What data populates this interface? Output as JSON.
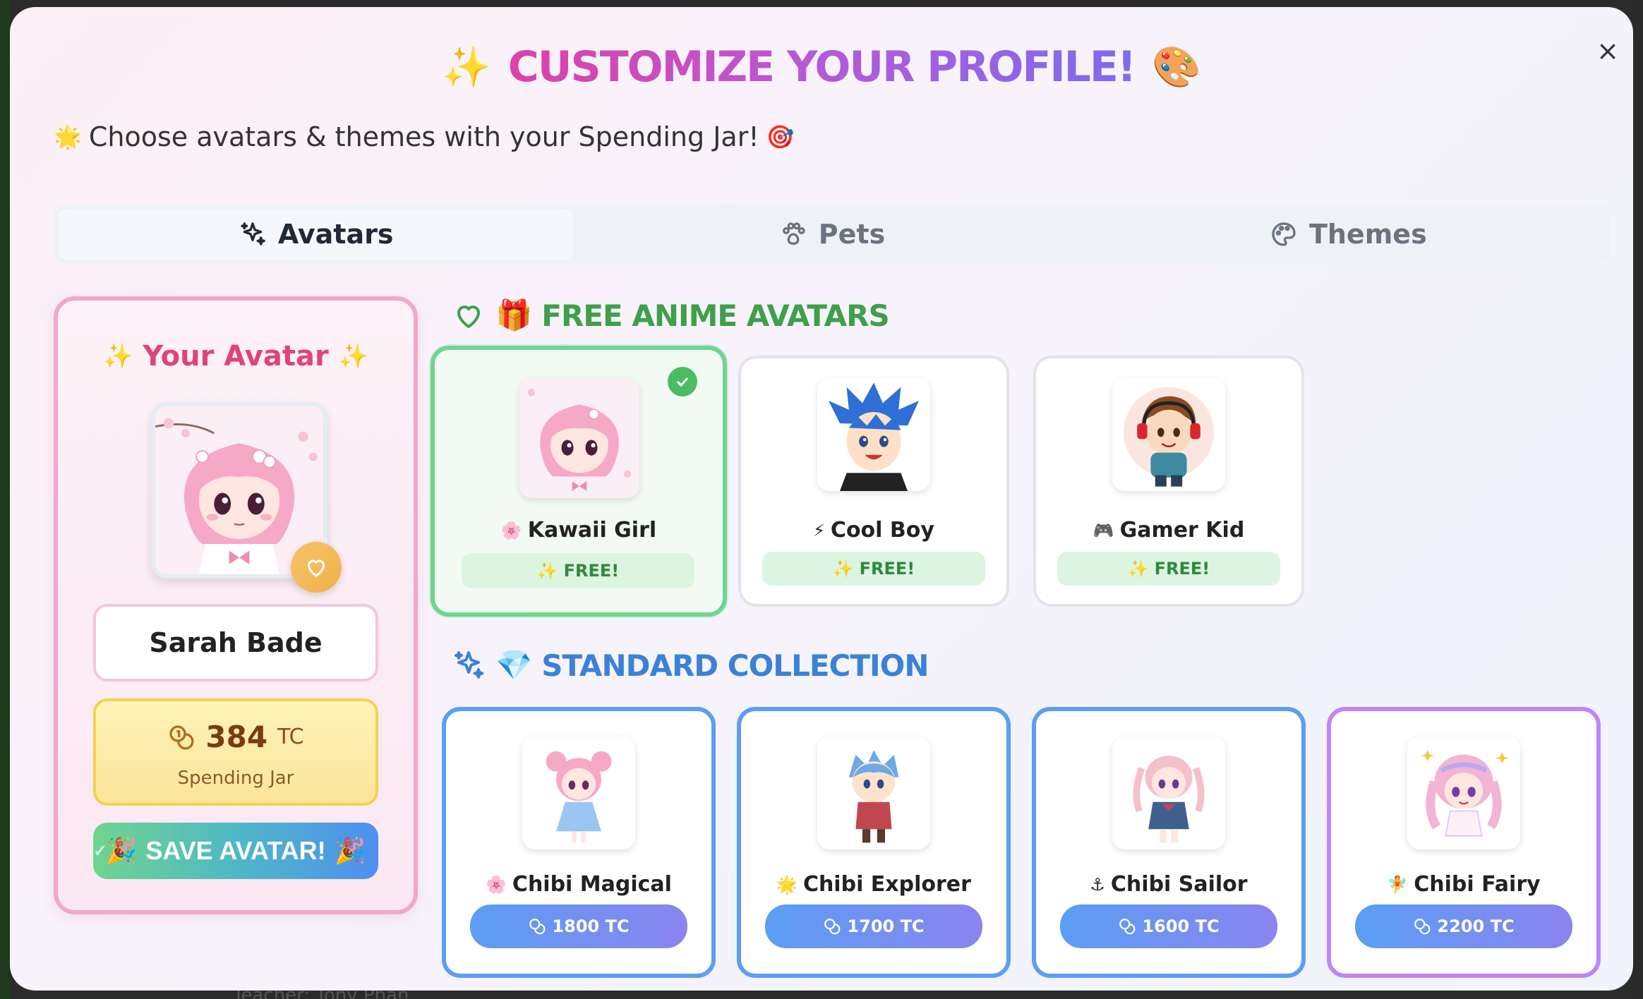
{
  "background": {
    "bottom_text": "Teacher: Tony Phan"
  },
  "modal": {
    "title": "CUSTOMIZE YOUR PROFILE!",
    "title_left_emoji": "✨",
    "title_right_emoji": "🎨",
    "subtitle_emoji": "🌟",
    "subtitle": "Choose avatars & themes with your Spending Jar!",
    "subtitle_end_emoji": "🎯",
    "close_label": "×"
  },
  "tabs": [
    {
      "label": "Avatars",
      "icon": "sparkles-icon",
      "active": true
    },
    {
      "label": "Pets",
      "icon": "paw-icon",
      "active": false
    },
    {
      "label": "Themes",
      "icon": "palette-icon",
      "active": false
    }
  ],
  "profile": {
    "heading": "Your Avatar",
    "heading_emoji": "✨",
    "name": "Sarah Bade",
    "balance": "384",
    "balance_unit": "TC",
    "balance_label": "Spending Jar",
    "save_label": "SAVE AVATAR!",
    "save_emoji": "🎉"
  },
  "sections": {
    "free_title": "FREE ANIME AVATARS",
    "free_emoji": "🎁",
    "standard_title": "STANDARD COLLECTION",
    "standard_emoji": "💎"
  },
  "free_avatars": [
    {
      "emoji": "🌸",
      "name": "Kawaii Girl",
      "badge": "FREE!",
      "badge_emoji": "✨",
      "selected": true
    },
    {
      "emoji": "⚡",
      "name": "Cool Boy",
      "badge": "FREE!",
      "badge_emoji": "✨",
      "selected": false
    },
    {
      "emoji": "🎮",
      "name": "Gamer Kid",
      "badge": "FREE!",
      "badge_emoji": "✨",
      "selected": false
    }
  ],
  "standard_avatars": [
    {
      "emoji": "🌸",
      "name": "Chibi Magical",
      "price": "1800 TC"
    },
    {
      "emoji": "🌟",
      "name": "Chibi Explorer",
      "price": "1700 TC"
    },
    {
      "emoji": "⚓",
      "name": "Chibi Sailor",
      "price": "1600 TC"
    },
    {
      "emoji": "🧚",
      "name": "Chibi Fairy",
      "price": "2200 TC"
    }
  ],
  "colors": {
    "free_accent": "#3ea04a",
    "standard_accent": "#3b82d6",
    "profile_accent": "#e0437a",
    "selected_border": "#6fd58e",
    "premium_border": "#c084fc"
  }
}
